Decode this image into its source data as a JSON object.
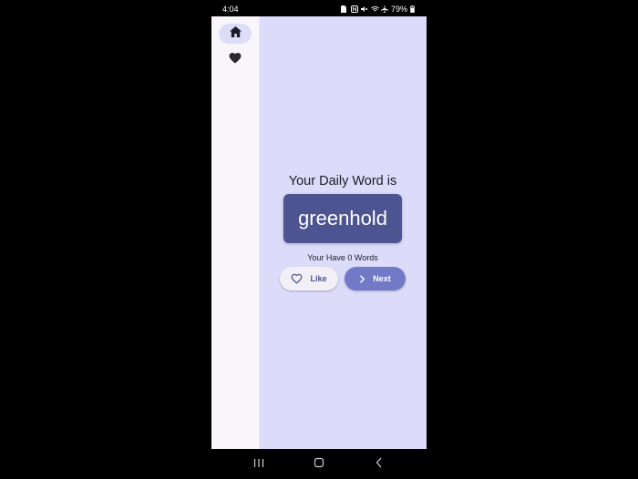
{
  "status_bar": {
    "time": "4:04",
    "battery": "79%"
  },
  "nav_rail": {
    "items": [
      {
        "icon": "home-icon",
        "selected": true
      },
      {
        "icon": "heart-icon",
        "selected": false
      }
    ]
  },
  "main": {
    "headline": "Your Daily Word is",
    "word": "greenhold",
    "count_text": "Your Have 0 Words",
    "like_label": "Like",
    "next_label": "Next"
  },
  "colors": {
    "background": "#dcdcfa",
    "card": "#4c5491",
    "next_button": "#727ac8",
    "rail": "#f8f6fb"
  },
  "system_nav": {
    "icons": [
      "recents-icon",
      "home-circle-icon",
      "back-icon"
    ]
  }
}
